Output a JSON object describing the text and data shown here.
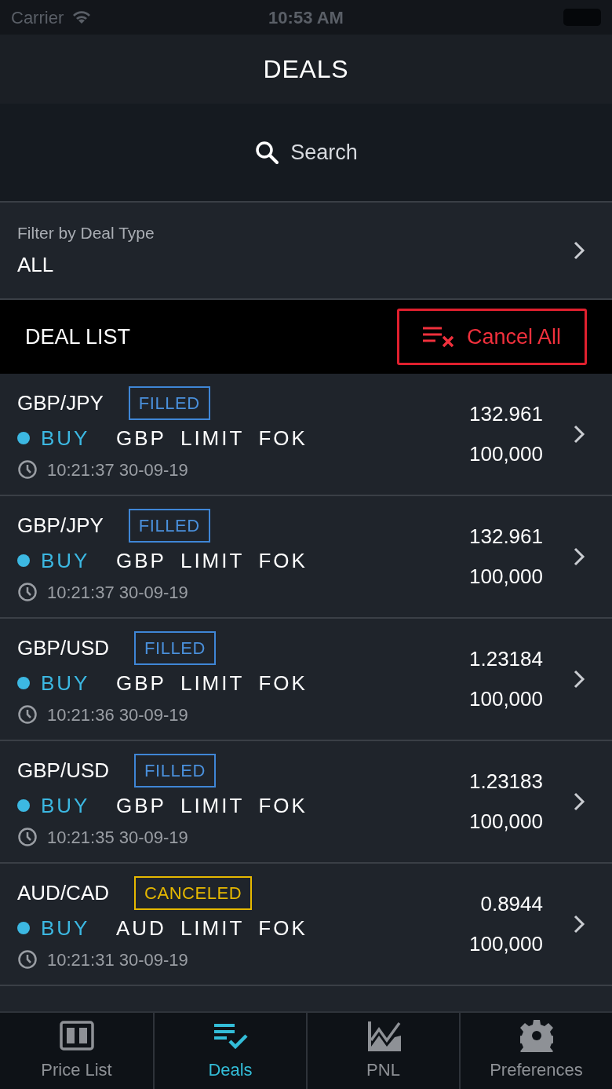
{
  "status_bar": {
    "carrier": "Carrier",
    "time": "10:53 AM"
  },
  "title": "DEALS",
  "search": {
    "placeholder": "Search"
  },
  "filter": {
    "label": "Filter by Deal Type",
    "value": "ALL"
  },
  "deal_list": {
    "title": "DEAL LIST",
    "cancel_all": "Cancel All"
  },
  "deals": [
    {
      "pair": "GBP/JPY",
      "status": "FILLED",
      "side": "BUY",
      "currency": "GBP",
      "order_type": "LIMIT",
      "tif": "FOK",
      "time": "10:21:37 30-09-19",
      "price": "132.961",
      "amount": "100,000"
    },
    {
      "pair": "GBP/JPY",
      "status": "FILLED",
      "side": "BUY",
      "currency": "GBP",
      "order_type": "LIMIT",
      "tif": "FOK",
      "time": "10:21:37 30-09-19",
      "price": "132.961",
      "amount": "100,000"
    },
    {
      "pair": "GBP/USD",
      "status": "FILLED",
      "side": "BUY",
      "currency": "GBP",
      "order_type": "LIMIT",
      "tif": "FOK",
      "time": "10:21:36 30-09-19",
      "price": "1.23184",
      "amount": "100,000"
    },
    {
      "pair": "GBP/USD",
      "status": "FILLED",
      "side": "BUY",
      "currency": "GBP",
      "order_type": "LIMIT",
      "tif": "FOK",
      "time": "10:21:35 30-09-19",
      "price": "1.23183",
      "amount": "100,000"
    },
    {
      "pair": "AUD/CAD",
      "status": "CANCELED",
      "side": "BUY",
      "currency": "AUD",
      "order_type": "LIMIT",
      "tif": "FOK",
      "time": "10:21:31 30-09-19",
      "price": "0.8944",
      "amount": "100,000"
    }
  ],
  "tabs": [
    {
      "label": "Price List",
      "kind": "prices",
      "selected": false
    },
    {
      "label": "Deals",
      "kind": "deals",
      "selected": true
    },
    {
      "label": "PNL",
      "kind": "pnl",
      "selected": false
    },
    {
      "label": "Preferences",
      "kind": "settings",
      "selected": false
    }
  ]
}
